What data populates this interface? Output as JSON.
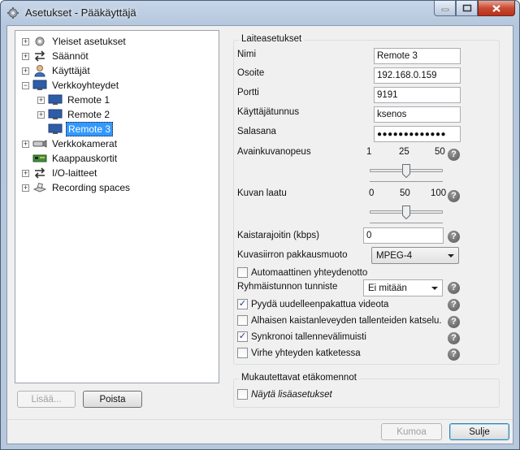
{
  "window": {
    "title": "Asetukset - Pääkäyttäjä"
  },
  "tree": {
    "items": [
      {
        "label": "Yleiset asetukset"
      },
      {
        "label": "Säännöt"
      },
      {
        "label": "Käyttäjät"
      },
      {
        "label": "Verkkoyhteydet"
      },
      {
        "label": "Remote 1"
      },
      {
        "label": "Remote 2"
      },
      {
        "label": "Remote 3"
      },
      {
        "label": "Verkkokamerat"
      },
      {
        "label": "Kaappauskortit"
      },
      {
        "label": "I/O-laitteet"
      },
      {
        "label": "Recording spaces"
      }
    ],
    "selected": "Remote 3"
  },
  "left_buttons": {
    "add": "Lisää...",
    "remove": "Poista"
  },
  "device_settings": {
    "group_title": "Laiteasetukset",
    "name_label": "Nimi",
    "name_value": "Remote 3",
    "address_label": "Osoite",
    "address_value": "192.168.0.159",
    "port_label": "Portti",
    "port_value": "9191",
    "username_label": "Käyttäjätunnus",
    "username_value": "ksenos",
    "password_label": "Salasana",
    "password_value": "●●●●●●●●●●●●●",
    "keyframe_label": "Avainkuvanopeus",
    "keyframe_ticks": [
      "1",
      "25",
      "50"
    ],
    "keyframe_value": 25,
    "quality_label": "Kuvan laatu",
    "quality_ticks": [
      "0",
      "50",
      "100"
    ],
    "quality_value": 50,
    "bandwidth_label": "Kaistarajoitin (kbps)",
    "bandwidth_value": "0",
    "compression_label": "Kuvasiirron pakkausmuoto",
    "compression_value": "MPEG-4",
    "auto_connect_label": "Automaattinen yhteydenotto",
    "auto_connect_checked": false,
    "group_id_label": "Ryhmäistunnon tunniste",
    "group_id_value": "Ei mitään",
    "repack_label": "Pyydä uudelleenpakattua videota",
    "repack_checked": true,
    "lowband_label": "Alhaisen kaistanleveyden tallenteiden katselu.",
    "lowband_checked": false,
    "sync_label": "Synkronoi tallennevälimuisti",
    "sync_checked": true,
    "error_label": "Virhe yhteyden katketessa",
    "error_checked": false
  },
  "custom_commands": {
    "group_title": "Mukautettavat etäkomennot",
    "show_more_label": "Näytä lisäasetukset",
    "show_more_checked": false
  },
  "bottom_buttons": {
    "undo": "Kumoa",
    "close": "Sulje"
  },
  "help_glyph": "?",
  "colors": {
    "selection": "#3399ff",
    "close_button": "#c94a34"
  }
}
